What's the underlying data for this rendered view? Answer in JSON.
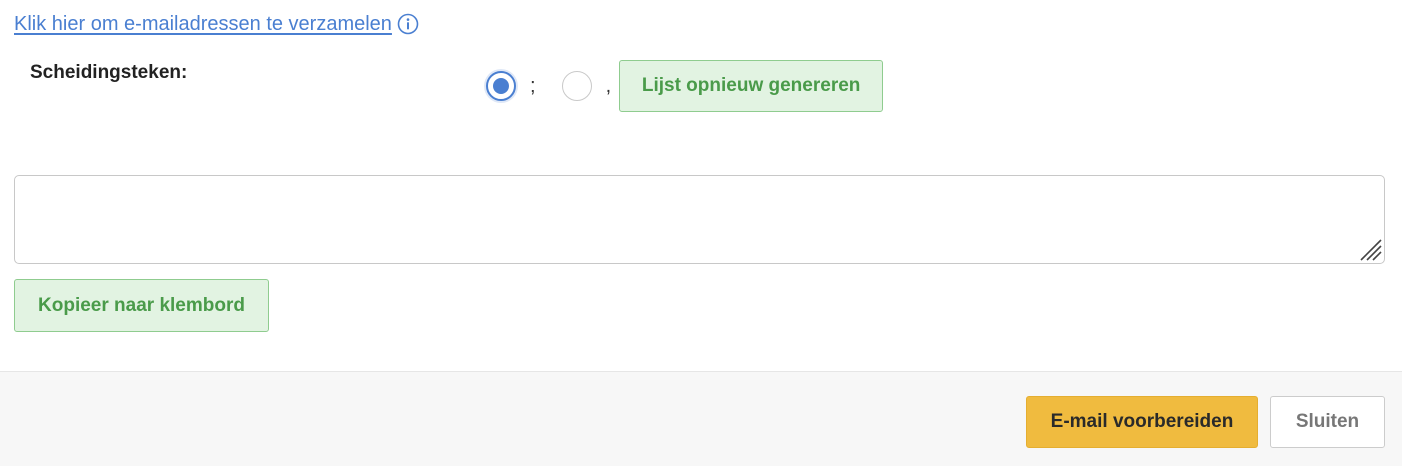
{
  "collect": {
    "link_text": "Klik hier om e-mailadressen te verzamelen",
    "info_icon": "info-circle-icon"
  },
  "separator": {
    "label": "Scheidingsteken:",
    "options": [
      {
        "symbol": ";",
        "selected": true
      },
      {
        "symbol": ",",
        "selected": false
      }
    ],
    "regenerate_label": "Lijst opnieuw genereren"
  },
  "emails": {
    "value": ""
  },
  "copy": {
    "label": "Kopieer naar klembord"
  },
  "footer": {
    "prepare_label": "E-mail voorbereiden",
    "close_label": "Sluiten"
  },
  "colors": {
    "link": "#4a7fd1",
    "radio_selected": "#4a7fd1",
    "green_button_bg": "#e2f3e2",
    "green_button_text": "#4a9b4a",
    "primary_button_bg": "#f0bb3f",
    "footer_bg": "#f7f7f7"
  }
}
